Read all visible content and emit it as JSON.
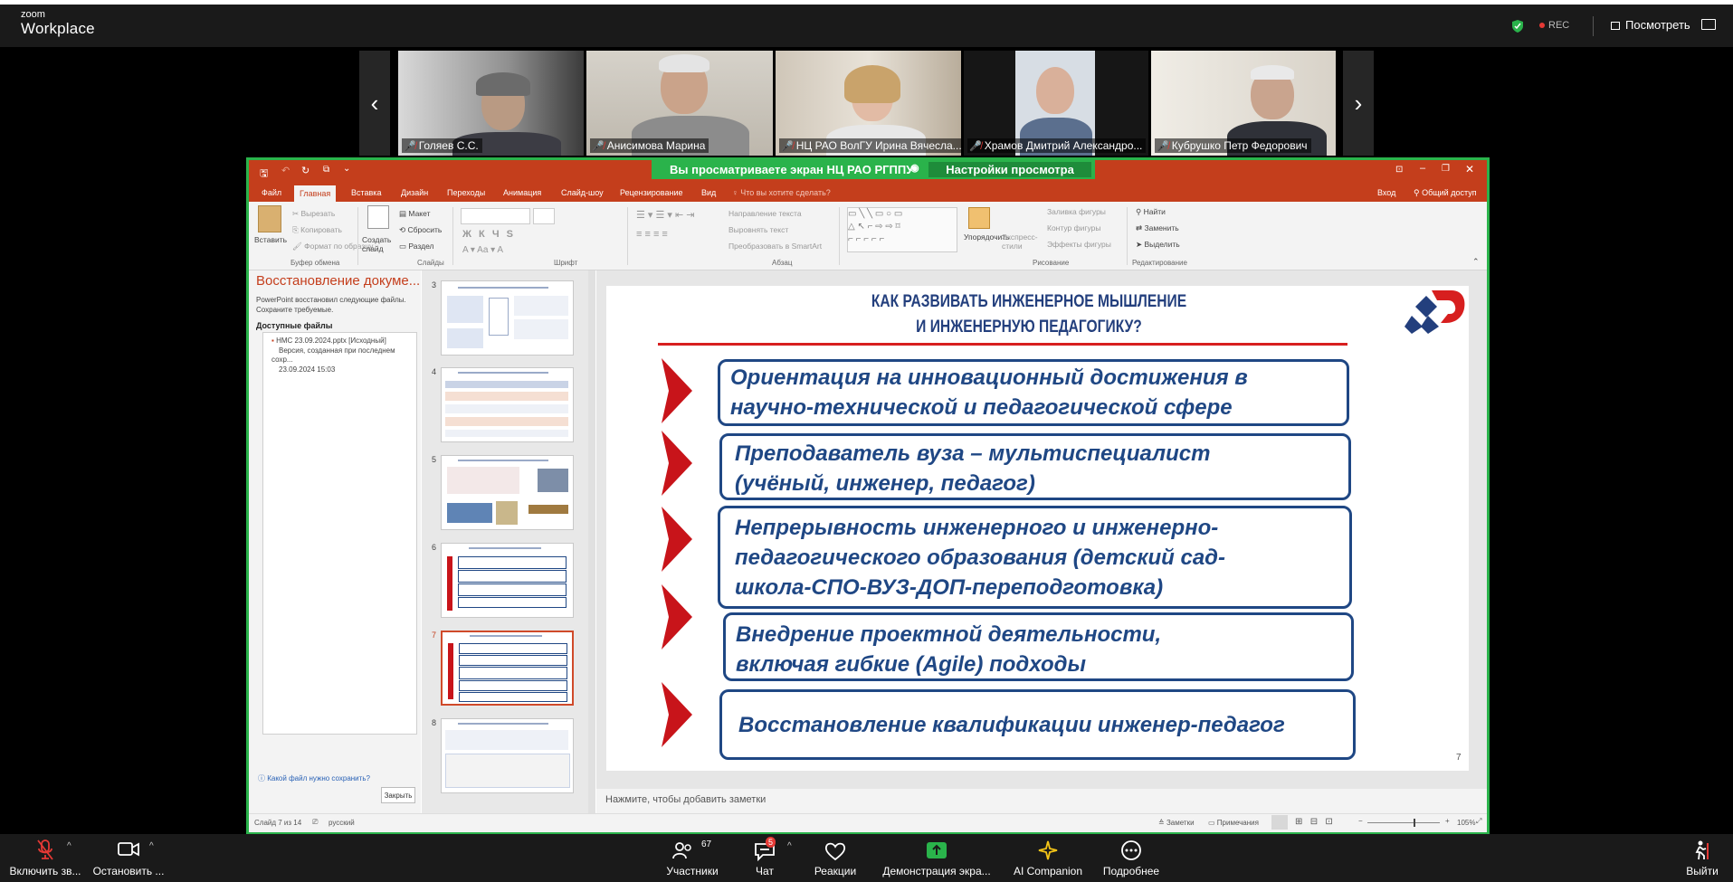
{
  "zoom": {
    "logo_small": "zoom",
    "logo_big": "Workplace",
    "rec_label": "REC",
    "view_label": "Посмотреть"
  },
  "participants": [
    {
      "name": "Голяев С.С."
    },
    {
      "name": "Анисимова Марина"
    },
    {
      "name": "НЦ РАО ВолГУ Ирина Вячесла..."
    },
    {
      "name": "Храмов Дмитрий Александро..."
    },
    {
      "name": "Кубрушко Петр Федорович"
    }
  ],
  "share_banner": {
    "text": "Вы просматриваете экран  НЦ РАО РГППУ",
    "settings": "Настройки просмотра"
  },
  "ppt": {
    "tabs": [
      "Файл",
      "Главная",
      "Вставка",
      "Дизайн",
      "Переходы",
      "Анимация",
      "Слайд-шоу",
      "Рецензирование",
      "Вид",
      "Что вы хотите сделать?"
    ],
    "right_links": {
      "login": "Вход",
      "share": "Общий доступ"
    },
    "ribbon": {
      "paste": "Вставить",
      "cut": "Вырезать",
      "copy": "Копировать",
      "format_painter": "Формат по образцу",
      "new_slide": "Создать слайд",
      "layout": "Макет",
      "reset": "Сбросить",
      "section": "Раздел",
      "text_direction": "Направление текста",
      "align_text": "Выровнять текст",
      "smartart": "Преобразовать в SmartArt",
      "arrange": "Упорядочить",
      "quick_styles": "Экспресс-стили",
      "shape_fill": "Заливка фигуры",
      "shape_outline": "Контур фигуры",
      "shape_effects": "Эффекты фигуры",
      "find": "Найти",
      "replace": "Заменить",
      "select": "Выделить",
      "groups": [
        "Буфер обмена",
        "Слайды",
        "Шрифт",
        "Абзац",
        "Рисование",
        "Редактирование"
      ]
    },
    "recovery": {
      "title": "Восстановление докуме...",
      "text": "PowerPoint восстановил следующие файлы. Сохраните требуемые.",
      "available": "Доступные файлы",
      "file_name": "НМС 23.09.2024.pptx  [Исходный]",
      "file_desc": "Версия, созданная при последнем сохр...",
      "file_date": "23.09.2024 15:03",
      "question": "Какой файл нужно сохранить?",
      "close": "Закрыть"
    },
    "thumb_numbers": [
      "3",
      "4",
      "5",
      "6",
      "7",
      "8"
    ],
    "notes_placeholder": "Нажмите, чтобы добавить заметки",
    "status": {
      "slide": "Слайд 7 из 14",
      "lang": "русский",
      "notes": "Заметки",
      "comments": "Примечания",
      "zoom": "105%"
    }
  },
  "slide": {
    "title_line1": "КАК РАЗВИВАТЬ ИНЖЕНЕРНОЕ МЫШЛЕНИЕ",
    "title_line2": "И ИНЖЕНЕРНУЮ ПЕДАГОГИКУ?",
    "number": "7",
    "items": [
      {
        "line1": "Ориентация на инновационный достижения в",
        "line2": "научно-технической и педагогической сфере"
      },
      {
        "line1": "Преподаватель вуза – мультиспециалист",
        "line2": "(учёный, инженер, педагог)"
      },
      {
        "line1": "Непрерывность инженерного и инженерно-",
        "line2": "педагогического образования (детский сад-",
        "line3": "школа-СПО-ВУЗ-ДОП-переподготовка)"
      },
      {
        "line1": "Внедрение проектной деятельности,",
        "line2": "включая гибкие (Agile) подходы"
      },
      {
        "line1": "Восстановление квалификации инженер-педагог"
      }
    ]
  },
  "bottom": {
    "audio": "Включить зв...",
    "video": "Остановить ...",
    "participants": "Участники",
    "participants_count": "67",
    "chat": "Чат",
    "chat_badge": "5",
    "reactions": "Реакции",
    "share": "Демонстрация экра...",
    "ai": "AI Companion",
    "more": "Подробнее",
    "leave": "Выйти"
  },
  "colors": {
    "accent_green": "#2ab34b",
    "ppt_red": "#c43e1c",
    "slide_blue": "#1f4784",
    "chevron_red": "#c8141a"
  }
}
